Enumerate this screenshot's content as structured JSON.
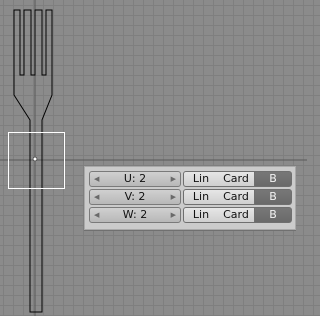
{
  "viewport": {
    "grid_color": "#7f7f7f",
    "background_color": "#8b8b8b",
    "object_outline_color": "#000000",
    "selection_box_color": "#ffffff"
  },
  "lattice_panel": {
    "rows": [
      {
        "label": "U: 2",
        "lin": "Lin",
        "card": "Card",
        "b": "B"
      },
      {
        "label": "V: 2",
        "lin": "Lin",
        "card": "Card",
        "b": "B"
      },
      {
        "label": "W: 2",
        "lin": "Lin",
        "card": "Card",
        "b": "B"
      }
    ]
  },
  "icons": {
    "decrement": "left-arrow-icon",
    "increment": "right-arrow-icon"
  }
}
